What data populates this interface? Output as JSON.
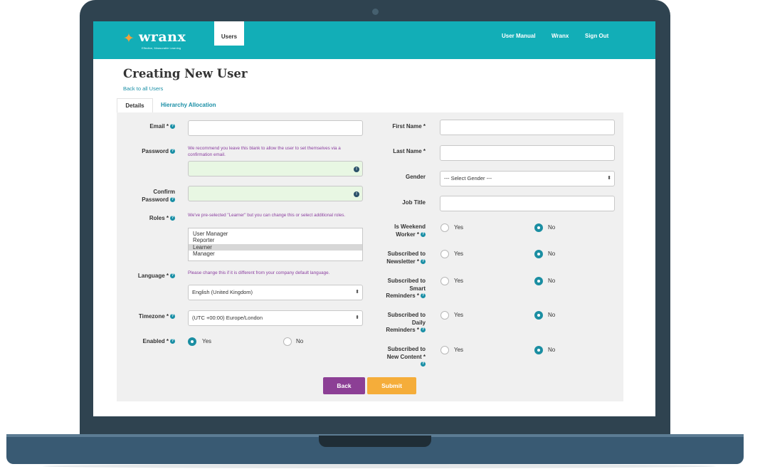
{
  "app": {
    "logo_text": "wranx",
    "logo_tagline": "Effective, Measurable Learning",
    "nav_tab": "Users",
    "nav_links": [
      "User Manual",
      "Wranx",
      "Sign Out"
    ]
  },
  "page": {
    "title": "Creating New User",
    "back_link": "Back to all Users",
    "tabs": [
      "Details",
      "Hierarchy Allocation"
    ]
  },
  "left": {
    "email_label": "Email *",
    "password_label": "Password",
    "password_hint": "We recommend you leave this blank to allow the user to set themselves via a confirmation email.",
    "confirm_label_1": "Confirm",
    "confirm_label_2": "Password",
    "roles_label": "Roles *",
    "roles_hint": "We've pre-selected \"Learner\" but you can change this or select additional roles.",
    "roles": [
      "User Manager",
      "Reporter",
      "Learner",
      "Manager"
    ],
    "roles_selected": "Learner",
    "language_label": "Language *",
    "language_hint": "Please change this if it is different from your company default language.",
    "language_value": "English (United Kingdom)",
    "timezone_label": "Timezone *",
    "timezone_value": "(UTC +00:00) Europe/London",
    "enabled_label": "Enabled *",
    "enabled_value": "Yes"
  },
  "right": {
    "first_name_label": "First Name *",
    "last_name_label": "Last Name *",
    "gender_label": "Gender",
    "gender_value": "--- Select Gender ---",
    "job_title_label": "Job Title",
    "radio_groups": [
      {
        "l1": "Is Weekend",
        "l2": "Worker *",
        "l3": "",
        "l4": "",
        "value": "No"
      },
      {
        "l1": "Subscribed to",
        "l2": "Newsletter *",
        "l3": "",
        "l4": "",
        "value": "No"
      },
      {
        "l1": "Subscribed to",
        "l2": "Smart",
        "l3": "Reminders *",
        "l4": "",
        "value": "No"
      },
      {
        "l1": "Subscribed to",
        "l2": "Daily",
        "l3": "Reminders *",
        "l4": "",
        "value": "No"
      },
      {
        "l1": "Subscribed to",
        "l2": "New Content *",
        "l3": "",
        "l4": "",
        "value": "No"
      }
    ]
  },
  "options": {
    "yes": "Yes",
    "no": "No"
  },
  "buttons": {
    "back": "Back",
    "submit": "Submit"
  },
  "colors": {
    "topbar": "#12aeb7",
    "primary": "#1b8ea2",
    "back_button": "#8c3f95",
    "submit_button": "#f5ad3a",
    "hint_text": "#8b3fa0"
  }
}
